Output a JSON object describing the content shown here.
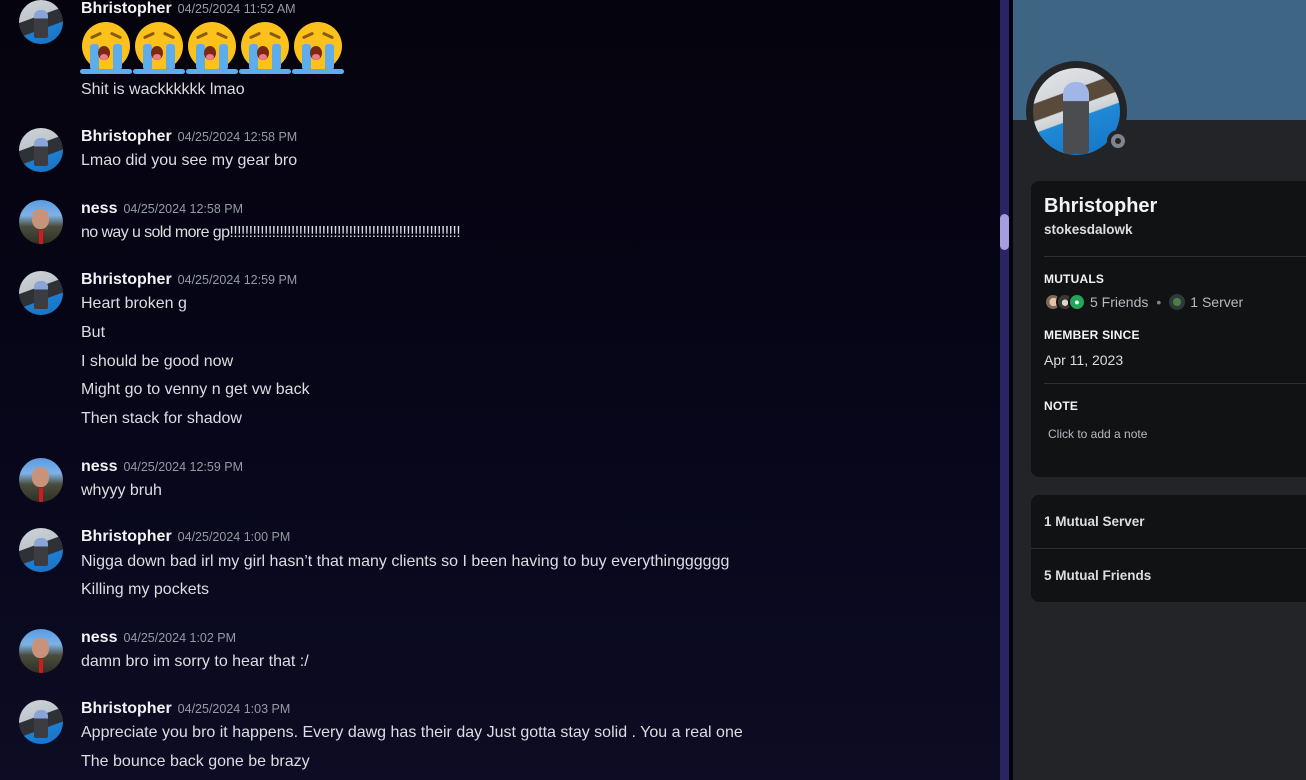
{
  "chat": {
    "messages": [
      {
        "author": "Bhristopher",
        "timestamp": "04/25/2024 11:52 AM",
        "emoji": [
          "loudly-crying-face",
          "loudly-crying-face",
          "loudly-crying-face",
          "loudly-crying-face",
          "loudly-crying-face"
        ],
        "lines": [
          "Shit is wackkkkkk lmao"
        ]
      },
      {
        "author": "Bhristopher",
        "timestamp": "04/25/2024 12:58 PM",
        "lines": [
          "Lmao did you see my gear bro"
        ]
      },
      {
        "author": "ness",
        "timestamp": "04/25/2024 12:58 PM",
        "lines": [
          "no way u sold more gp!!!!!!!!!!!!!!!!!!!!!!!!!!!!!!!!!!!!!!!!!!!!!!!!!!!!!!!!!!!!"
        ]
      },
      {
        "author": "Bhristopher",
        "timestamp": "04/25/2024 12:59 PM",
        "lines": [
          "Heart broken g",
          "But",
          "I should be good now",
          "Might go to venny n get vw back",
          "Then stack for shadow"
        ]
      },
      {
        "author": "ness",
        "timestamp": "04/25/2024 12:59 PM",
        "lines": [
          "whyyy bruh"
        ]
      },
      {
        "author": "Bhristopher",
        "timestamp": "04/25/2024 1:00 PM",
        "lines": [
          "Nigga down bad irl my girl hasn’t that many clients so I been having to buy everythingggggg",
          "Killing my pockets"
        ]
      },
      {
        "author": "ness",
        "timestamp": "04/25/2024 1:02 PM",
        "lines": [
          "damn bro im sorry to hear that :/"
        ]
      },
      {
        "author": "Bhristopher",
        "timestamp": "04/25/2024 1:03 PM",
        "lines": [
          "Appreciate you bro it happens. Every dawg has their day Just gotta stay solid . You a real one",
          "The bounce back gone be brazy"
        ]
      }
    ]
  },
  "profile": {
    "display_name": "Bhristopher",
    "username": "stokesdalowk",
    "status": "offline",
    "mutuals": {
      "title": "MUTUALS",
      "friends_text": "5 Friends",
      "separator": "•",
      "servers_text": "1 Server"
    },
    "member_since": {
      "title": "MEMBER SINCE",
      "date": "Apr 11, 2023"
    },
    "note": {
      "title": "NOTE",
      "placeholder": "Click to add a note"
    },
    "links": {
      "mutual_servers": "1 Mutual Server",
      "mutual_friends": "5 Mutual Friends"
    }
  },
  "colors": {
    "banner": "#3f6585",
    "scrollbar_thumb": "#a49ee0",
    "scrollbar_track": "#2b2463",
    "discord_green": "#23a55a"
  }
}
